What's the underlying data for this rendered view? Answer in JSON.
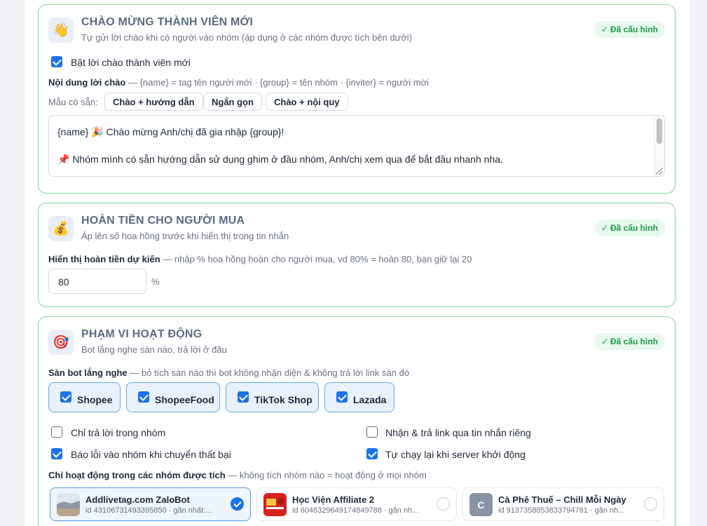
{
  "welcome": {
    "icon": "waving-hand-icon",
    "title": "CHÀO MỪNG THÀNH VIÊN MỚI",
    "subtitle": "Tự gửi lời chào khi có người vào nhóm (áp dụng ở các nhóm được tích bên dưới)",
    "status": "Đã cấu hình",
    "enable_label": "Bật lời chào thành viên mới",
    "enable_checked": true,
    "content_label": "Nội dung lời chào",
    "content_hint": " — {name} = tag tên người mới · {group} = tên nhóm · {inviter} = người mời",
    "templates_label": "Mẫu có sẵn:",
    "templates": [
      "Chào + hướng dẫn",
      "Ngắn gọn",
      "Chào + nội quy"
    ],
    "message_line1": "{name} 🎉 Chào mừng Anh/chị đã gia nhập {group}!",
    "message_line2": "📌 Nhóm mình có sẵn hướng dẫn sử dụng ghim ở đầu nhóm, Anh/chị xem qua để bắt đầu nhanh nha."
  },
  "cashback": {
    "icon": "money-bag-icon",
    "title": "HOÀN TIỀN CHO NGƯỜI MUA",
    "subtitle": "Áp lên số hoa hồng trước khi hiển thị trong tin nhắn",
    "status": "Đã cấu hình",
    "field_label": "Hiển thị hoàn tiền dự kiến",
    "field_hint": " — nhập % hoa hồng hoàn cho người mua, vd 80% = hoàn 80, bạn giữ lại 20",
    "value": "80",
    "unit": "%"
  },
  "scope": {
    "icon": "target-icon",
    "title": "PHẠM VI HOẠT ĐỘNG",
    "subtitle": "Bot lắng nghe sàn nào, trả lời ở đâu",
    "status": "Đã cấu hình",
    "platforms_label": "Sàn bot lắng nghe",
    "platforms_hint": " — bỏ tích sàn nào thì bot không nhận diện & không trả lời link sàn đó",
    "platforms": [
      {
        "label": "Shopee",
        "checked": true
      },
      {
        "label": "ShopeeFood",
        "checked": true
      },
      {
        "label": "TikTok Shop",
        "checked": true
      },
      {
        "label": "Lazada",
        "checked": true
      }
    ],
    "options": [
      {
        "label": "Chỉ trả lời trong nhóm",
        "checked": false
      },
      {
        "label": "Nhận & trả link qua tin nhắn riêng",
        "checked": false
      },
      {
        "label": "Báo lỗi vào nhóm khi chuyển thất bại",
        "checked": true
      },
      {
        "label": "Tự chạy lại khi server khởi động",
        "checked": true
      }
    ],
    "groups_label": "Chỉ hoạt động trong các nhóm được tích",
    "groups_hint": " — không tích nhóm nào = hoạt động ở mọi nhóm",
    "groups": [
      {
        "name": "Addlivetag.com ZaloBot",
        "id": "id 4310673149339585​0 · gần nhất:...",
        "selected": true,
        "avatar": "landscape-photo"
      },
      {
        "name": "Học Viện Affiliate 2",
        "id": "id 6048329649174849788 · gần nh...",
        "selected": false,
        "avatar": "red-banner"
      },
      {
        "name": "Cà Phê Thuế – Chill Mỗi Ngày",
        "id": "id 9137358853833794781 · gần nh...",
        "selected": false,
        "avatar": "C"
      }
    ]
  }
}
